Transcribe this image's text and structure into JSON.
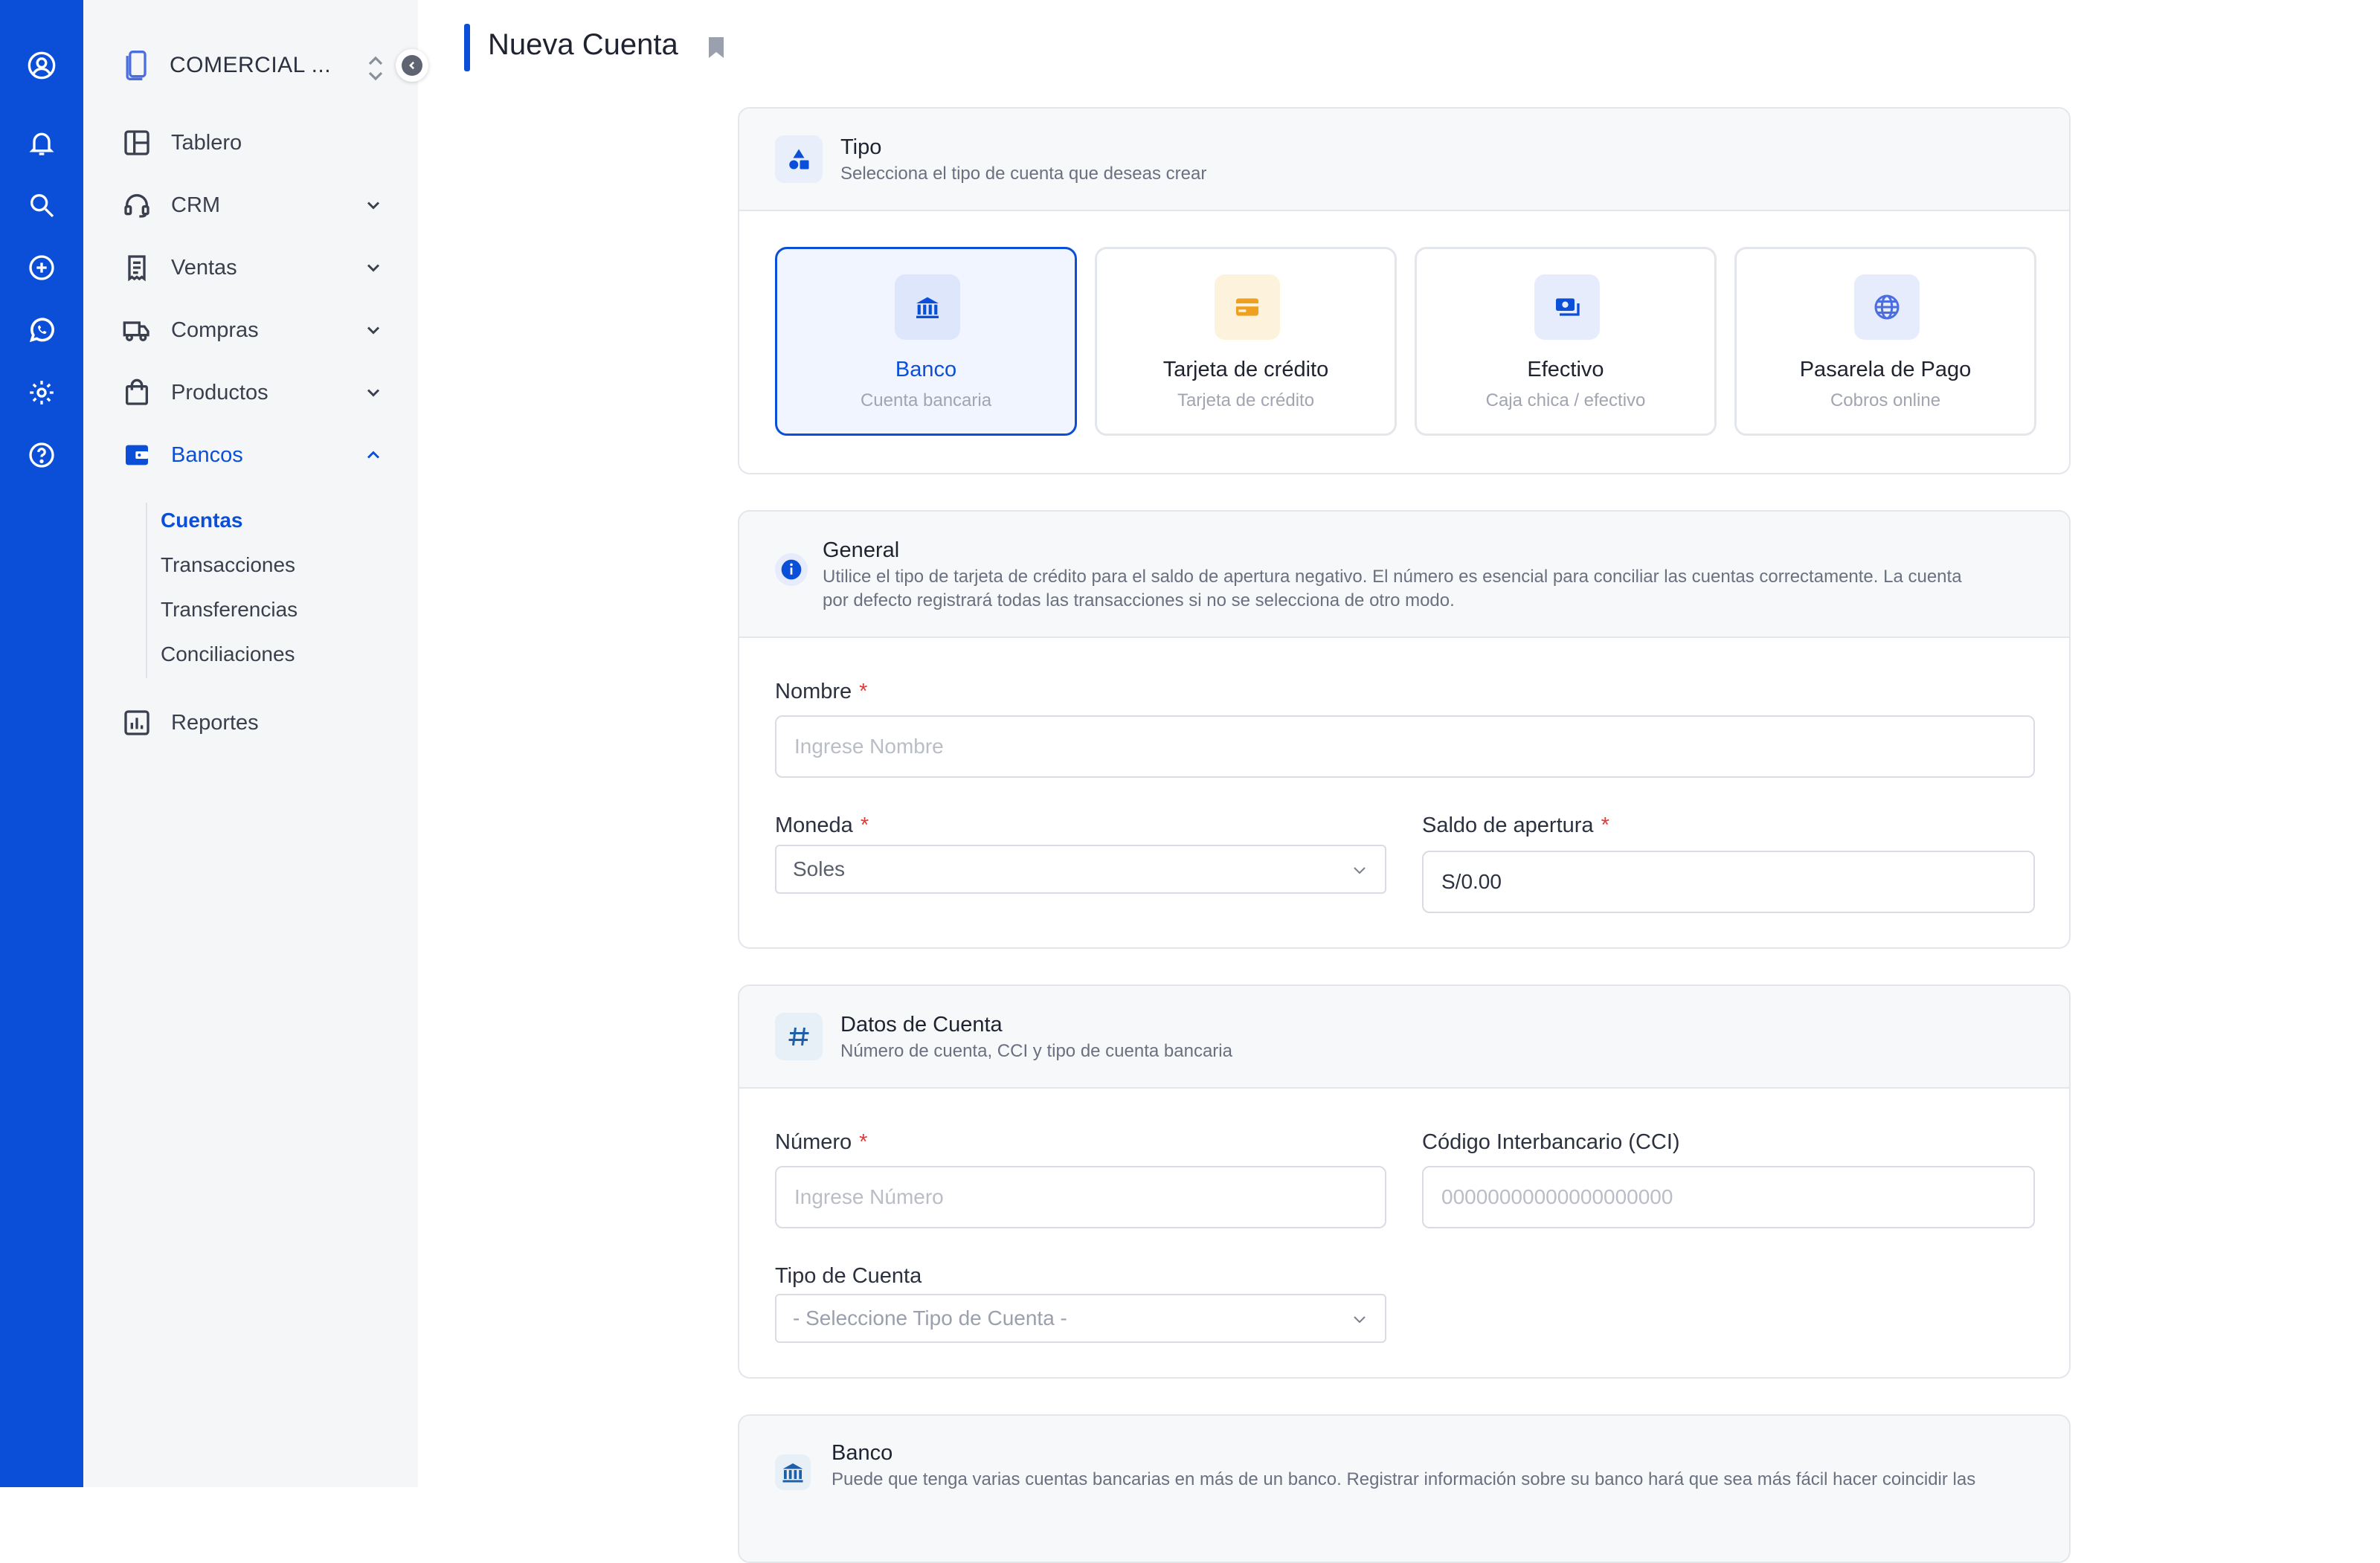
{
  "sidebar": {
    "org_name": "COMERCIAL ...",
    "nav": [
      {
        "label": "Tablero",
        "icon": "layout-icon"
      },
      {
        "label": "CRM",
        "icon": "headset-icon"
      },
      {
        "label": "Ventas",
        "icon": "receipt-icon"
      },
      {
        "label": "Compras",
        "icon": "truck-icon"
      },
      {
        "label": "Productos",
        "icon": "bag-icon"
      },
      {
        "label": "Bancos",
        "icon": "wallet-icon"
      },
      {
        "label": "Reportes",
        "icon": "chart-icon"
      }
    ],
    "bancos_sub": [
      "Cuentas",
      "Transacciones",
      "Transferencias",
      "Conciliaciones"
    ]
  },
  "page": {
    "title": "Nueva Cuenta"
  },
  "tipo": {
    "title": "Tipo",
    "subtitle": "Selecciona el tipo de cuenta que deseas crear",
    "options": [
      {
        "title": "Banco",
        "sub": "Cuenta bancaria",
        "icon": "bank-icon",
        "color": "#0b4fd8"
      },
      {
        "title": "Tarjeta de crédito",
        "sub": "Tarjeta de crédito",
        "icon": "credit-card-icon",
        "color": "#f0a020"
      },
      {
        "title": "Efectivo",
        "sub": "Caja chica / efectivo",
        "icon": "cash-icon",
        "color": "#0b4fd8"
      },
      {
        "title": "Pasarela de Pago",
        "sub": "Cobros online",
        "icon": "globe-icon",
        "color": "#4a6ee0"
      }
    ]
  },
  "general": {
    "title": "General",
    "desc_1": "Utilice el tipo de tarjeta de crédito para el saldo de apertura negativo. El número es esencial para conciliar las cuentas correctamente. La cuenta",
    "desc_2": "por defecto registrará todas las transacciones si no se selecciona de otro modo.",
    "nombre_label": "Nombre",
    "nombre_placeholder": "Ingrese Nombre",
    "moneda_label": "Moneda",
    "moneda_value": "Soles",
    "saldo_label": "Saldo de apertura",
    "saldo_value": "S/0.00",
    "required_mark": "*"
  },
  "datos": {
    "title": "Datos de Cuenta",
    "subtitle": "Número de cuenta, CCI y tipo de cuenta bancaria",
    "numero_label": "Número",
    "numero_placeholder": "Ingrese Número",
    "cci_label": "Código Interbancario (CCI)",
    "cci_placeholder": "00000000000000000000",
    "tipo_label": "Tipo de Cuenta",
    "tipo_placeholder": "- Seleccione Tipo de Cuenta -"
  },
  "banco": {
    "title": "Banco",
    "desc": "Puede que tenga varias cuentas bancarias en más de un banco. Registrar información sobre su banco hará que sea más fácil hacer coincidir las"
  },
  "colors": {
    "primary": "#0b4fd8",
    "required": "#e03a3a",
    "accent_yellow": "#f0a020"
  }
}
